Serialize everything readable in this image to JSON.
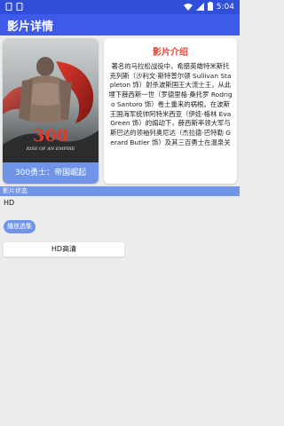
{
  "status_bar": {
    "time": "5:04",
    "icons": [
      "notification-icon",
      "notification-icon",
      "wifi-icon",
      "signal-icon",
      "battery-icon"
    ]
  },
  "app_bar": {
    "title": "影片详情"
  },
  "poster": {
    "caption": "300勇士：帝国崛起",
    "art_text": "300 RISE OF AN EMPIRE"
  },
  "intro": {
    "title": "影片介绍",
    "text": "著名的马拉松战役中，希腊英雄特米斯托克列斯（沙利文·斯特普尔顿 Sullivan Stapleton 饰）射杀波斯国王大流士王，从此埋下薛西斯一世（罗德里格·桑托罗 Rodrigo Santoro 饰）卷土重来的祸根。在波斯王国海军统帅阿特米西亚（伊娃·格林 Eva Green 饰）的煽动下，薛西斯率领大军与斯巴达的领袖列奥尼达（杰拉德·巴特勒 Gerard Butler 饰）及其三百勇士在温泉关"
  },
  "section": {
    "label": "影片状态"
  },
  "status": {
    "quality": "HD",
    "play_label": "播放选集",
    "source_item": "HD高清"
  },
  "colors": {
    "status_bar": "#2f4fd8",
    "app_bar": "#3d5ae8",
    "accent": "#6f94e8",
    "title_red": "#e24a3a",
    "background": "#ececec"
  }
}
